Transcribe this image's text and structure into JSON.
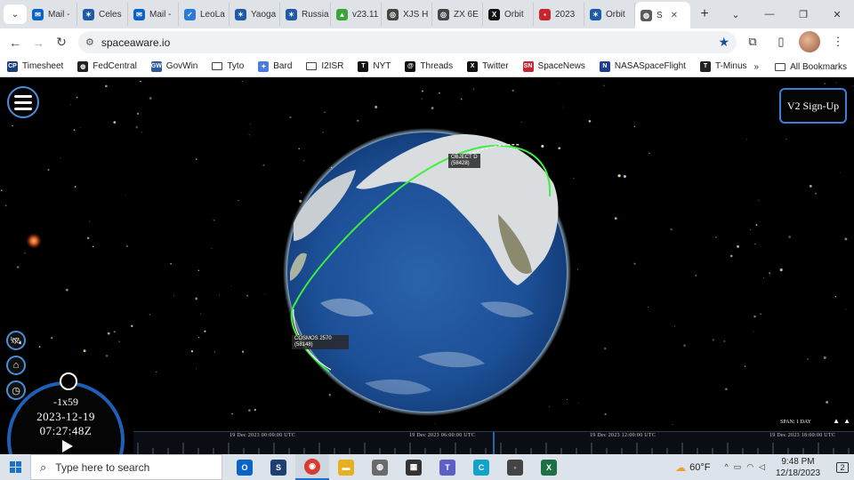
{
  "browser": {
    "tabs": [
      {
        "label": "Mail -",
        "icon": "outlook-icon",
        "color": "#0a64c8",
        "glyph": "✉"
      },
      {
        "label": "Celes",
        "icon": "star-icon",
        "color": "#1e5aa8",
        "glyph": "✶"
      },
      {
        "label": "Mail -",
        "icon": "outlook-icon",
        "color": "#0a64c8",
        "glyph": "✉"
      },
      {
        "label": "LeoLa",
        "icon": "leolabs-icon",
        "color": "#2a7ad6",
        "glyph": "✓"
      },
      {
        "label": "Yaoga",
        "icon": "star-icon",
        "color": "#1e5aa8",
        "glyph": "✶"
      },
      {
        "label": "Russia",
        "icon": "star-icon",
        "color": "#1e5aa8",
        "glyph": "✶"
      },
      {
        "label": "v23.11",
        "icon": "release-icon",
        "color": "#3aa63a",
        "glyph": "▲"
      },
      {
        "label": "XJS H",
        "icon": "orbit-icon",
        "color": "#444444",
        "glyph": "◎"
      },
      {
        "label": "ZX 6E",
        "icon": "orbit-icon",
        "color": "#444444",
        "glyph": "◎"
      },
      {
        "label": "Orbit",
        "icon": "x-icon",
        "color": "#111111",
        "glyph": "X"
      },
      {
        "label": "2023",
        "icon": "news-icon",
        "color": "#c8262f",
        "glyph": "▪"
      },
      {
        "label": "Orbit",
        "icon": "star-icon",
        "color": "#1e5aa8",
        "glyph": "✶"
      },
      {
        "label": "S",
        "icon": "globe-icon",
        "color": "#5a5a5a",
        "glyph": "◍",
        "active": true
      }
    ],
    "url": "spaceaware.io",
    "bookmarks": [
      {
        "label": "Timesheet",
        "icon": "cp-icon",
        "color": "#1a3f7a",
        "glyph": "CP"
      },
      {
        "label": "FedCentral",
        "icon": "globe-icon",
        "color": "#222222",
        "glyph": "◍"
      },
      {
        "label": "GovWin",
        "icon": "gw-icon",
        "color": "#2c5d9a",
        "glyph": "GW"
      },
      {
        "label": "Tyto",
        "icon": "folder-icon",
        "folder": true
      },
      {
        "label": "Bard",
        "icon": "bard-icon",
        "color": "#4a7ce0",
        "glyph": "✦"
      },
      {
        "label": "I2ISR",
        "icon": "folder-icon",
        "folder": true
      },
      {
        "label": "NYT",
        "icon": "nyt-icon",
        "color": "#111111",
        "glyph": "T"
      },
      {
        "label": "Threads",
        "icon": "threads-icon",
        "color": "#111111",
        "glyph": "@"
      },
      {
        "label": "Twitter",
        "icon": "x-icon",
        "color": "#111111",
        "glyph": "X"
      },
      {
        "label": "SpaceNews",
        "icon": "spacenews-icon",
        "color": "#c8262f",
        "glyph": "SN"
      },
      {
        "label": "NASASpaceFlight",
        "icon": "nsf-icon",
        "color": "#1e3d8a",
        "glyph": "N"
      },
      {
        "label": "T-Minus",
        "icon": "tminus-icon",
        "color": "#222222",
        "glyph": "T"
      }
    ],
    "bookmarks_more": "»",
    "all_bookmarks": "All Bookmarks"
  },
  "app": {
    "signup_label": "V2 Sign-Up",
    "satellites": [
      {
        "name": "OBJECT D",
        "id": "(58428)"
      },
      {
        "name": "COSMOS 2570",
        "id": "(58148)"
      }
    ],
    "clock": {
      "speed": "-1x59",
      "date": "2023-12-19",
      "time": "07:27:48Z"
    },
    "timeline": {
      "span_label": "SPAN: 1 DAY",
      "ticks": [
        "19 Dec 2023 00:00:00 UTC",
        "19 Dec 2023 06:00:00 UTC",
        "19 Dec 2023 12:00:00 UTC",
        "19 Dec 2023 18:00:00 UTC"
      ]
    },
    "colors": {
      "accent": "#3d7ed6",
      "orbit": "#3ef03e",
      "ocean": "#1c4f96"
    }
  },
  "taskbar": {
    "search_placeholder": "Type here to search",
    "apps": [
      {
        "icon": "outlook-icon",
        "color": "#0a64c8",
        "glyph": "O"
      },
      {
        "icon": "s-app-icon",
        "color": "#1f3f72",
        "glyph": "S"
      },
      {
        "icon": "chrome-icon",
        "color": "#d93b30",
        "glyph": "◉",
        "active": true
      },
      {
        "icon": "file-explorer-icon",
        "color": "#e8b021",
        "glyph": "▬"
      },
      {
        "icon": "earth-icon",
        "color": "#6a6a6a",
        "glyph": "◍"
      },
      {
        "icon": "calculator-icon",
        "color": "#333333",
        "glyph": "▦"
      },
      {
        "icon": "teams-icon",
        "color": "#5b5fc7",
        "glyph": "T"
      },
      {
        "icon": "canva-icon",
        "color": "#13a3c7",
        "glyph": "C"
      },
      {
        "icon": "copilot-icon",
        "color": "#444444",
        "glyph": "◦"
      },
      {
        "icon": "excel-icon",
        "color": "#1d7044",
        "glyph": "X"
      }
    ],
    "weather": "60°F",
    "time": "9:48 PM",
    "date": "12/18/2023",
    "notifications": "2"
  }
}
